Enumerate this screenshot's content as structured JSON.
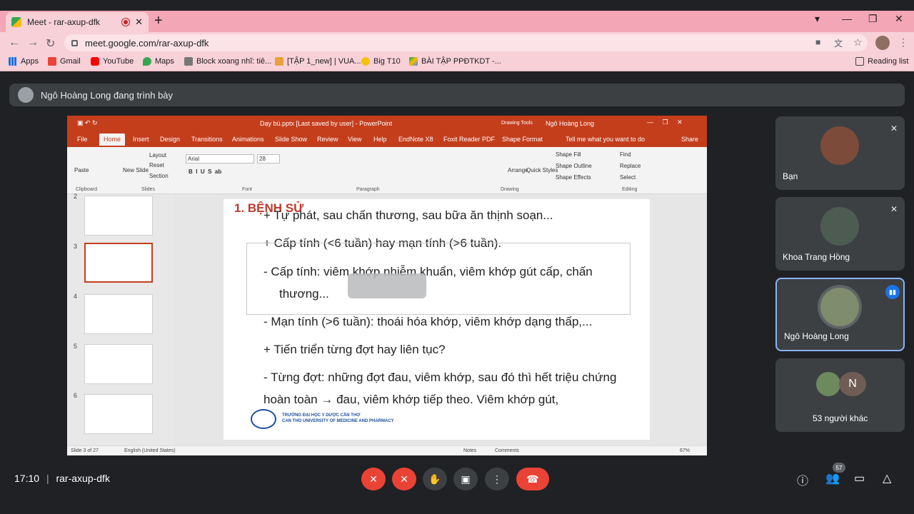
{
  "browser": {
    "tab_title": "Meet - rar-axup-dfk",
    "new_tab": "+",
    "url": "meet.google.com/rar-axup-dfk",
    "minimize": "—",
    "maximize": "❐",
    "close": "✕",
    "bookmarks": [
      "Apps",
      "Gmail",
      "YouTube",
      "Maps",
      "Block xoang nhĩ: tiê...",
      "[TẬP 1_new] | VUA...",
      "Big T10",
      "BÀI TẬP PPĐTKDT -..."
    ],
    "reading_list": "Reading list"
  },
  "presenter_bar": {
    "text": "Ngô Hoàng Long đang trình bày"
  },
  "ppt": {
    "window_title": "Dạy bù.pptx [Last saved by user] - PowerPoint",
    "drawing_tools": "Drawing Tools",
    "user": "Ngô Hoàng Long",
    "tabs": [
      "File",
      "Home",
      "Insert",
      "Design",
      "Transitions",
      "Animations",
      "Slide Show",
      "Review",
      "View",
      "Help",
      "EndNote X8",
      "Foxit Reader PDF",
      "Shape Format"
    ],
    "tell_me": "Tell me what you want to do",
    "share": "Share",
    "ribbon": {
      "paste": "Paste",
      "new_slide": "New Slide",
      "layout": "Layout",
      "reset": "Reset",
      "section": "Section",
      "font_name": "Arial",
      "font_size": "28",
      "arrange": "Arrange",
      "quick_styles": "Quick Styles",
      "shape_fill": "Shape Fill",
      "shape_outline": "Shape Outline",
      "shape_effects": "Shape Effects",
      "find": "Find",
      "replace": "Replace",
      "select": "Select",
      "groups": [
        "Clipboard",
        "Slides",
        "Font",
        "Paragraph",
        "Drawing",
        "Editing"
      ]
    },
    "thumb_numbers": [
      "2",
      "3",
      "4",
      "5",
      "6"
    ],
    "slide": {
      "title": "1. BỆNH SỬ",
      "lines": [
        "+ Tự phát, sau chấn thương, sau bữa ăn thịnh soạn...",
        "+ Cấp tính (<6 tuần) hay mạn tính (>6 tuần).",
        "-   Cấp tính: viêm khớp nhiễm khuẩn, viêm khớp gút cấp, chấn",
        "thương...",
        "-   Mạn tính (>6 tuần): thoái hóa khớp, viêm khớp dạng thấp,...",
        "+ Tiến triển từng đợt hay liên tục?",
        "- Từng đợt: những đợt đau, viêm khớp, sau đó thì hết triệu chứng",
        "hoàn toàn → đau, viêm khớp tiếp theo. Viêm khớp gút,"
      ],
      "footer1": "TRƯỜNG ĐẠI HỌC Y DƯỢC CẦN THƠ",
      "footer2": "CAN THO UNIVERSITY OF MEDICINE AND PHARMACY"
    },
    "status": {
      "slide": "Slide 3 of 27",
      "lang": "English (United States)",
      "notes": "Notes",
      "comments": "Comments",
      "zoom": "67%"
    }
  },
  "participants": [
    {
      "name": "Bạn",
      "muted": true
    },
    {
      "name": "Khoa Trang Hồng",
      "muted": true
    },
    {
      "name": "Ngô Hoàng Long",
      "speaking": true
    },
    {
      "name": "53 người khác",
      "initial": "N"
    }
  ],
  "bottom": {
    "time": "17:10",
    "separator": "|",
    "meeting_code": "rar-axup-dfk",
    "participant_count": "57"
  }
}
